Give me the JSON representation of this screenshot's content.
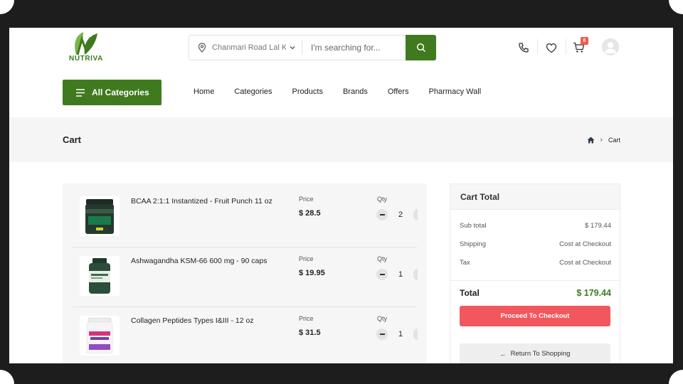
{
  "brand": {
    "name": "NUTRIVA",
    "accent": "#3f7a1f",
    "danger": "#f2575d"
  },
  "search": {
    "location": "Chanmari Road Lal Kl",
    "placeholder": "I'm searching for..."
  },
  "header": {
    "icons": [
      "phone-icon",
      "heart-icon",
      "cart-icon"
    ],
    "cart_count": "6"
  },
  "menu": {
    "all_categories": "All Categories",
    "nav": [
      "Home",
      "Categories",
      "Products",
      "Brands",
      "Offers",
      "Pharmacy Wall"
    ]
  },
  "page": {
    "title": "Cart",
    "breadcrumb_current": "Cart"
  },
  "cart": {
    "price_label": "Price",
    "qty_label": "Qty",
    "items": [
      {
        "name": "BCAA 2:1:1 Instantized - Fruit Punch 11 oz",
        "price": "$ 28.5",
        "qty": "2"
      },
      {
        "name": "Ashwagandha KSM-66 600 mg - 90 caps",
        "price": "$ 19.95",
        "qty": "1"
      },
      {
        "name": "Collagen Peptides Types I&III - 12 oz",
        "price": "$ 31.5",
        "qty": "1"
      }
    ]
  },
  "totals": {
    "heading": "Cart Total",
    "subtotal_label": "Sub total",
    "subtotal_value": "$ 179.44",
    "shipping_label": "Shipping",
    "shipping_value": "Cost at Checkout",
    "tax_label": "Tax",
    "tax_value": "Cost at Checkout",
    "total_label": "Total",
    "total_value": "$ 179.44",
    "checkout_label": "Proceed To Checkout",
    "return_label": "Return To Shopping"
  }
}
